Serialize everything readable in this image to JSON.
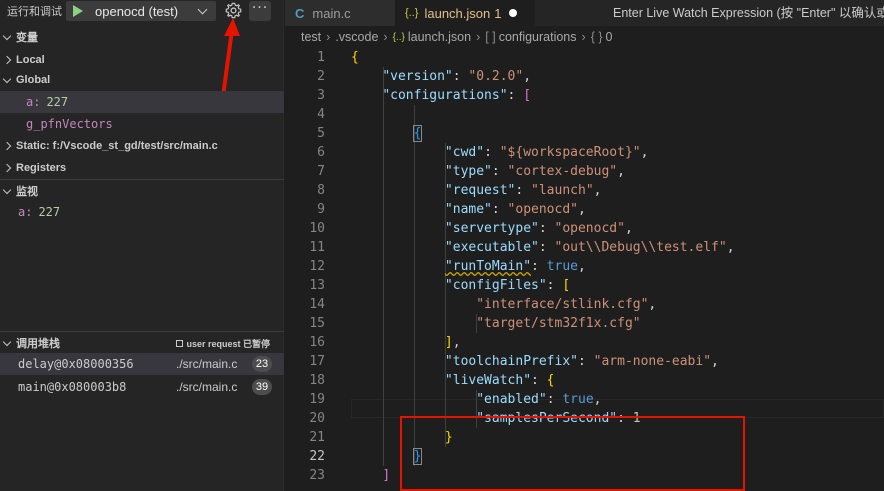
{
  "debug_toolbar": {
    "run_label": "运行和调试",
    "config_name": "openocd (test)",
    "more_label": "···"
  },
  "variables": {
    "title": "变量",
    "local_label": "Local",
    "global_label": "Global",
    "globals": [
      {
        "name": "a:",
        "value": "227"
      },
      {
        "name": "g_pfnVectors",
        "value": ""
      }
    ],
    "static_label": "Static: f:/Vscode_st_gd/test/src/main.c",
    "registers_label": "Registers"
  },
  "watch": {
    "title": "监视",
    "items": [
      {
        "name": "a:",
        "value": "227"
      }
    ]
  },
  "call_stack": {
    "title": "调用堆栈",
    "pause_note": "user request 已暂停",
    "frames": [
      {
        "frame": "delay@0x08000356",
        "file": "./src/main.c",
        "line": "23"
      },
      {
        "frame": "main@0x080003b8",
        "file": "./src/main.c",
        "line": "39"
      }
    ]
  },
  "tabs": [
    {
      "label": "main.c",
      "kind": "c"
    },
    {
      "label": "launch.json",
      "kind": "json",
      "modified_count": "1"
    }
  ],
  "quick_input_text": "Enter Live Watch Expression (按 \"Enter\" 以确认或",
  "breadcrumb": {
    "items": [
      "test",
      ".vscode",
      "launch.json",
      "configurations",
      "0"
    ]
  },
  "editor": {
    "current_line": "22",
    "lines": [
      {
        "n": "1"
      },
      {
        "n": "2"
      },
      {
        "n": "3"
      },
      {
        "n": "4"
      },
      {
        "n": "5"
      },
      {
        "n": "6"
      },
      {
        "n": "7"
      },
      {
        "n": "8"
      },
      {
        "n": "9"
      },
      {
        "n": "10"
      },
      {
        "n": "11"
      },
      {
        "n": "12"
      },
      {
        "n": "13"
      },
      {
        "n": "14"
      },
      {
        "n": "15"
      },
      {
        "n": "16"
      },
      {
        "n": "17"
      },
      {
        "n": "18"
      },
      {
        "n": "19"
      },
      {
        "n": "20"
      },
      {
        "n": "21"
      },
      {
        "n": "22"
      },
      {
        "n": "23"
      }
    ],
    "code": {
      "version_key": "\"version\"",
      "version_val": "\"0.2.0\"",
      "configurations_key": "\"configurations\"",
      "cwd_key": "\"cwd\"",
      "cwd_val": "\"${workspaceRoot}\"",
      "type_key": "\"type\"",
      "type_val": "\"cortex-debug\"",
      "request_key": "\"request\"",
      "request_val": "\"launch\"",
      "name_key": "\"name\"",
      "name_val": "\"openocd\"",
      "servertype_key": "\"servertype\"",
      "servertype_val": "\"openocd\"",
      "executable_key": "\"executable\"",
      "executable_val": "\"out\\\\Debug\\\\test.elf\"",
      "runtomain_key": "\"runToMain\"",
      "runtomain_val": "true",
      "configfiles_key": "\"configFiles\"",
      "cfg1": "\"interface/stlink.cfg\"",
      "cfg2": "\"target/stm32f1x.cfg\"",
      "toolchain_key": "\"toolchainPrefix\"",
      "toolchain_val": "\"arm-none-eabi\"",
      "livewatch_key": "\"liveWatch\"",
      "enabled_key": "\"enabled\"",
      "enabled_val": "true",
      "samples_key": "\"samplesPerSecond\"",
      "samples_val": "1"
    }
  },
  "colors": {
    "accent_red": "#e51400",
    "play_green": "#89d185"
  }
}
